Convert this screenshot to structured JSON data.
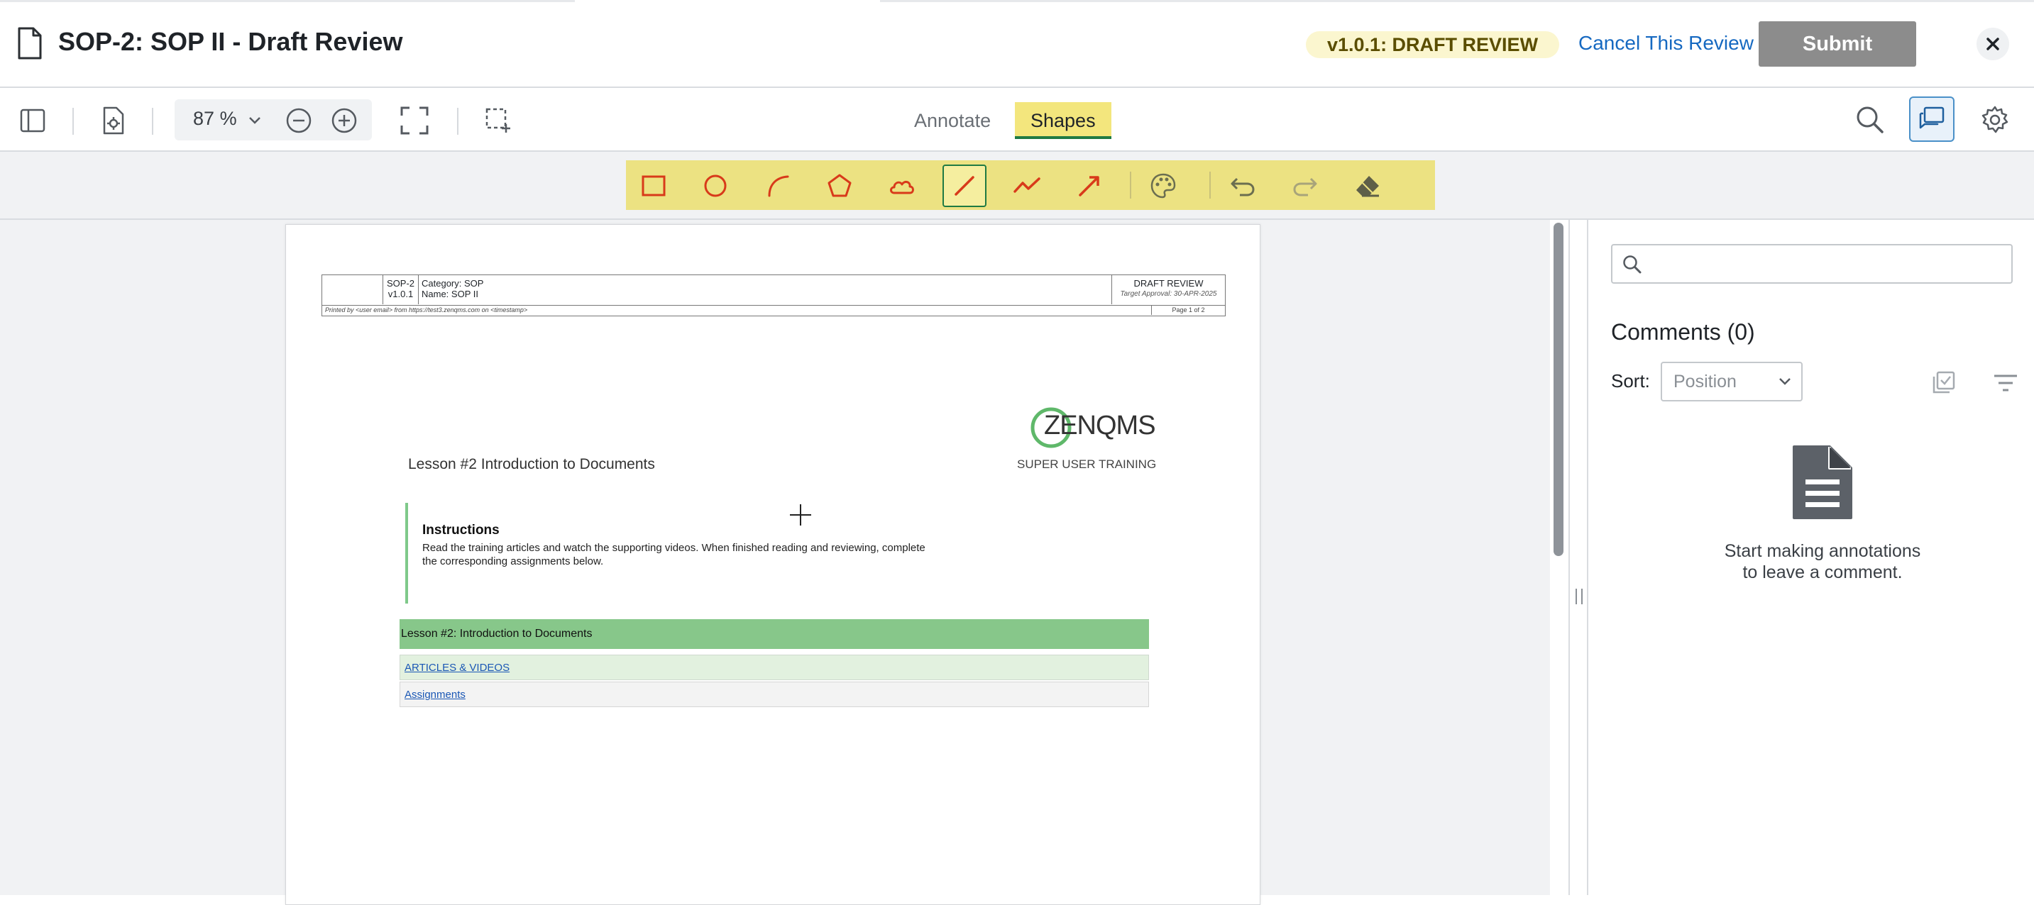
{
  "header": {
    "title": "SOP-2: SOP II - Draft Review",
    "version_badge": "v1.0.1: DRAFT REVIEW",
    "cancel_label": "Cancel This Review",
    "submit_label": "Submit"
  },
  "toolbar": {
    "zoom_value": "87",
    "zoom_unit": "%",
    "tabs": [
      {
        "label": "Annotate",
        "active": false
      },
      {
        "label": "Shapes",
        "active": true
      }
    ]
  },
  "shapes_toolbar": {
    "tools": [
      "rectangle-icon",
      "ellipse-icon",
      "arc-icon",
      "polygon-icon",
      "cloud-icon",
      "line-icon",
      "polyline-icon",
      "arrow-icon",
      "palette-icon",
      "undo-icon",
      "redo-icon",
      "eraser-icon"
    ],
    "active_tool": "line-icon",
    "accent_color": "#d83a1a",
    "bar_color": "#ece282"
  },
  "document": {
    "header_code": "SOP-2",
    "header_version": "v1.0.1",
    "category_label": "Category:",
    "category_value": "SOP",
    "name_label": "Name:",
    "name_value": "SOP II",
    "status": "DRAFT REVIEW",
    "target_approval": "Target Approval: 30-APR-2025",
    "printed_by": "Printed by <user email> from https://test3.zenqms.com on <timestamp>",
    "page_label": "Page 1 of 2",
    "logo_text": "ZENQMS",
    "logo_subtitle": "SUPER USER TRAINING",
    "lesson_heading": "Lesson #2 Introduction to Documents",
    "instructions_title": "Instructions",
    "instructions_text": "Read the training articles and watch the supporting videos. When finished reading and reviewing, complete the corresponding assignments below.",
    "lesson_bar": "Lesson #2: Introduction to Documents",
    "link_articles": "ARTICLES & VIDEOS",
    "link_assignments": "Assignments"
  },
  "comments_panel": {
    "search_value": "",
    "search_placeholder": "",
    "heading": "Comments (0)",
    "sort_label": "Sort:",
    "sort_value": "Position",
    "empty_line1": "Start making annotations",
    "empty_line2": "to leave a comment."
  }
}
